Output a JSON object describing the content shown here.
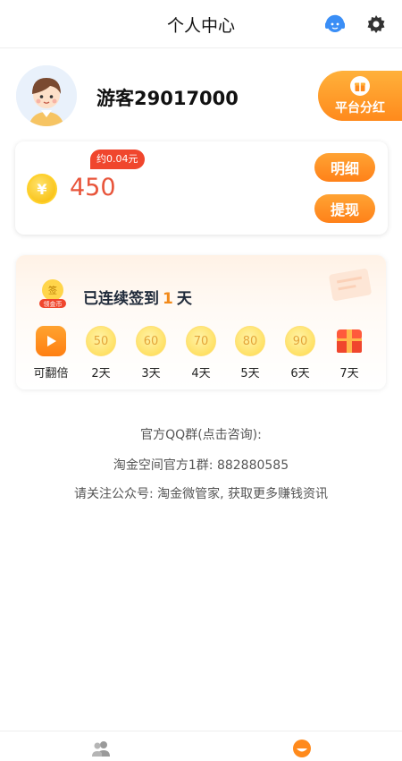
{
  "header": {
    "title": "个人中心"
  },
  "profile": {
    "username": "游客29017000",
    "dividend_label": "平台分红"
  },
  "wallet": {
    "coins": "450",
    "approx": "约0.04元",
    "detail_label": "明细",
    "withdraw_label": "提现"
  },
  "checkin": {
    "badge_top": "签",
    "badge_bottom": "领金币",
    "streak_prefix": "已连续签到",
    "streak_days": "1",
    "streak_suffix": "天",
    "days": [
      {
        "value": "",
        "label": "可翻倍"
      },
      {
        "value": "50",
        "label": "2天"
      },
      {
        "value": "60",
        "label": "3天"
      },
      {
        "value": "70",
        "label": "4天"
      },
      {
        "value": "80",
        "label": "5天"
      },
      {
        "value": "90",
        "label": "6天"
      },
      {
        "value": "",
        "label": "7天"
      }
    ]
  },
  "info": {
    "qq_group_title": "官方QQ群(点击咨询):",
    "qq_group": "淘金空间官方1群: 882880585",
    "wechat": "请关注公众号: 淘金微管家, 获取更多赚钱资讯"
  },
  "colors": {
    "accent": "#ff8a1c",
    "amount": "#e8553b",
    "badge": "#f0462d"
  },
  "icons": {
    "header_left": "customer-service-icon",
    "header_right": "gear-icon",
    "tab_left": "users-icon",
    "tab_right": "profile-face-icon"
  }
}
